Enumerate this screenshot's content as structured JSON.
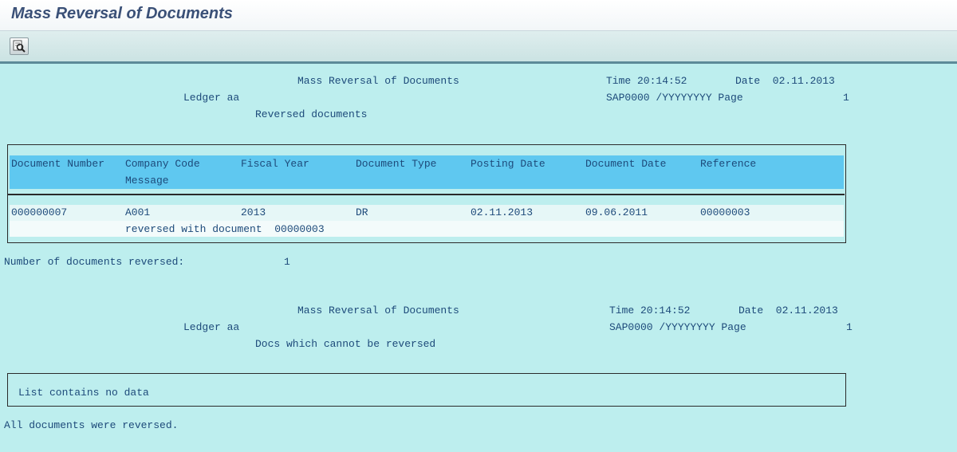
{
  "window": {
    "title": "Mass Reversal of Documents"
  },
  "toolbar": {
    "icons": [
      "detail-view-icon"
    ]
  },
  "report1": {
    "title": "Mass Reversal of Documents",
    "time": "Time 20:14:52",
    "date": "Date  02.11.2013",
    "ledger": "Ledger aa",
    "sys": "SAP0000 /YYYYYYYY Page",
    "page": "1",
    "subtitle": "Reversed documents",
    "columns": {
      "doc_number": "Document Number",
      "company_code": "Company Code",
      "fiscal_year": "Fiscal Year",
      "doc_type": "Document Type",
      "posting_date": "Posting Date",
      "doc_date": "Document Date",
      "reference": "Reference",
      "message": "Message"
    },
    "rows": [
      {
        "doc_number": "000000007",
        "company_code": "A001",
        "fiscal_year": "2013",
        "doc_type": "DR",
        "posting_date": "02.11.2013",
        "doc_date": "09.06.2011",
        "reference": "00000003",
        "message": "reversed with document  00000003"
      }
    ],
    "count_label": "Number of documents reversed:",
    "count_value": "1"
  },
  "report2": {
    "title": "Mass Reversal of Documents",
    "time": "Time 20:14:52",
    "date": "Date  02.11.2013",
    "ledger": "Ledger aa",
    "sys": "SAP0000 /YYYYYYYY Page",
    "page": "1",
    "subtitle": "Docs which cannot be reversed",
    "empty_text": "List contains no data",
    "footer": "All documents were reversed."
  }
}
